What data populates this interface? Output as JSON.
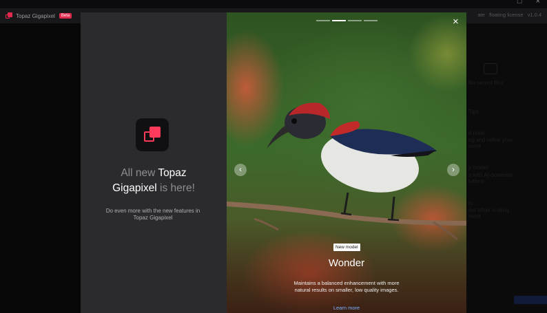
{
  "window": {
    "controls": [
      "□",
      "×"
    ]
  },
  "app": {
    "name": "Topaz Gigapixel",
    "badge": "Beta",
    "right_text_1": "ate",
    "right_text_2": "floating license",
    "version": "v1.0.4"
  },
  "background": {
    "recent_files": "No recent files",
    "tips": "Tips",
    "tip_1_title": "d pixel",
    "tip_1_line1": "ng and refine your",
    "tip_1_line2": "ment",
    "tip_2_title": "y model",
    "tip_2_line1": "s with AI-powered",
    "tip_2_line2": "lutions",
    "tip_3_title": "ts",
    "tip_3_line1": "out other scaling",
    "tip_3_line2": "ment"
  },
  "left_panel": {
    "headline_part1": "All new ",
    "headline_bold1": "Topaz",
    "headline_bold2": "Gigapixel",
    "headline_part2": " is here!",
    "subtext": "Do even more with the new features in Topaz Gigapixel"
  },
  "carousel": {
    "slides_total": 4,
    "active_index": 1,
    "prev_label": "‹",
    "next_label": "›",
    "close_label": "×",
    "badge": "New model",
    "title": "Wonder",
    "description": "Maintains a balanced enhancement with more natural results on smaller, low quality images.",
    "link": "Learn more"
  },
  "colors": {
    "accent": "#e0294d",
    "icon_pink": "#ff3b5c",
    "link": "#7fb0ff",
    "panel": "#2b2b2e"
  }
}
